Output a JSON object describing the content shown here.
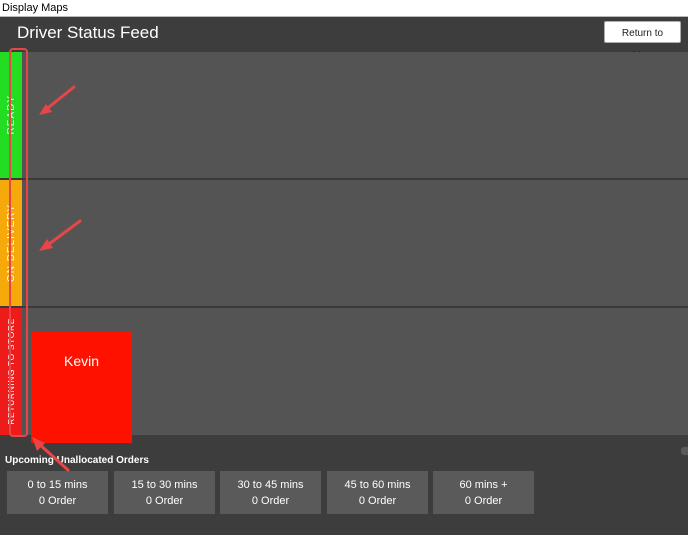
{
  "window": {
    "title": "Display Maps"
  },
  "header": {
    "title": "Driver Status Feed",
    "return_button": "Return to Map"
  },
  "lanes": [
    {
      "label": "READY",
      "color": "#22dd22",
      "drivers": []
    },
    {
      "label": "ON DELIVERY",
      "color": "#f5a90a",
      "drivers": []
    },
    {
      "label": "RETURNING TO STORE",
      "color": "#ee1b1b",
      "drivers": [
        {
          "name": "Kevin",
          "color": "#ff1100"
        }
      ]
    }
  ],
  "orders": {
    "title": "Upcoming Unallocated Orders",
    "buckets": [
      {
        "range": "0 to 15 mins",
        "count": "0 Order"
      },
      {
        "range": "15 to 30 mins",
        "count": "0 Order"
      },
      {
        "range": "30 to 45 mins",
        "count": "0 Order"
      },
      {
        "range": "45 to 60 mins",
        "count": "0 Order"
      },
      {
        "range": "60 mins +",
        "count": "0 Order"
      }
    ]
  },
  "annotations": {
    "highlight_color": "#e84646",
    "arrow_color": "#e84646"
  }
}
